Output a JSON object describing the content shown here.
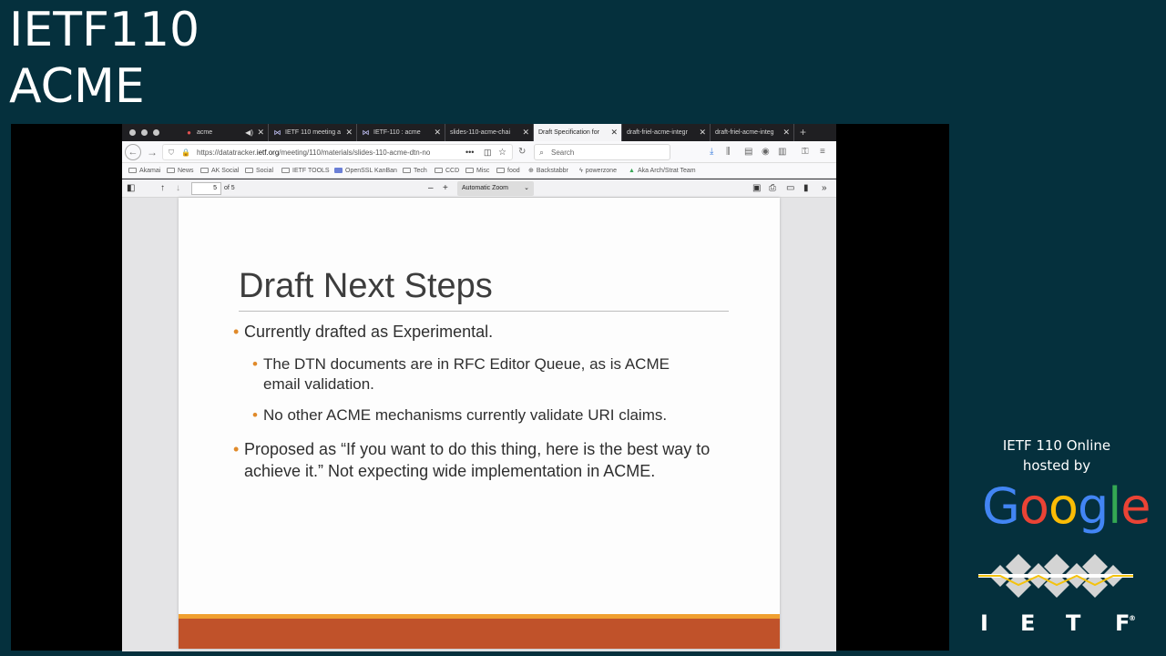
{
  "meeting": {
    "title_line1": "IETF110",
    "title_line2": "ACME"
  },
  "browser": {
    "tabs": [
      {
        "label": "acme",
        "icon": "github-cat-icon",
        "sound": true
      },
      {
        "label": "IETF 110 meeting a",
        "icon": "meetecho-icon"
      },
      {
        "label": "IETF-110 : acme",
        "icon": "meetecho-icon"
      },
      {
        "label": "slides-110-acme-chai",
        "icon": ""
      },
      {
        "label": "Draft Specification for",
        "icon": "",
        "active": true
      },
      {
        "label": "draft-friel-acme-integr",
        "icon": ""
      },
      {
        "label": "draft-friel-acme-integ",
        "icon": ""
      }
    ],
    "new_tab_symbol": "+",
    "url_prefix": "https://datatracker.",
    "url_domain": "ietf.org",
    "url_path": "/meeting/110/materials/slides-110-acme-dtn-no",
    "search_placeholder": "Search",
    "bookmarks": [
      "Akamai",
      "News",
      "AK Social",
      "Social",
      "IETF TOOLS",
      "OpenSSL KanBan",
      "Tech",
      "CCD",
      "Misc",
      "food",
      "Backstabbr",
      "powerzone",
      "Aka Arch/Strat Team"
    ],
    "pdf": {
      "page_number": "5",
      "page_count": "of 5",
      "zoom": "Automatic Zoom",
      "zoom_out": "–",
      "zoom_in": "+"
    }
  },
  "slide": {
    "title": "Draft Next Steps",
    "bullets": [
      {
        "level": 1,
        "text": "Currently drafted as Experimental."
      },
      {
        "level": 2,
        "text": "The DTN documents are in RFC Editor Queue, as is ACME email validation."
      },
      {
        "level": 2,
        "text": "No other ACME mechanisms currently validate URI claims."
      },
      {
        "level": 1,
        "text": "Proposed as “If you want to do this thing, here is the best way to achieve it.” Not expecting wide implementation in ACME."
      }
    ],
    "accent_color": "#e08a2a",
    "band_color": "#c0522a"
  },
  "sponsor": {
    "line1": "IETF 110 Online",
    "line2": "hosted by",
    "google_letters": [
      {
        "char": "G",
        "color": "#4285F4"
      },
      {
        "char": "o",
        "color": "#EA4335"
      },
      {
        "char": "o",
        "color": "#FBBC05"
      },
      {
        "char": "g",
        "color": "#4285F4"
      },
      {
        "char": "l",
        "color": "#34A853"
      },
      {
        "char": "e",
        "color": "#EA4335"
      }
    ],
    "ietf_letters": [
      "I",
      "E",
      "T",
      "F"
    ],
    "ietf_mark": "®"
  }
}
